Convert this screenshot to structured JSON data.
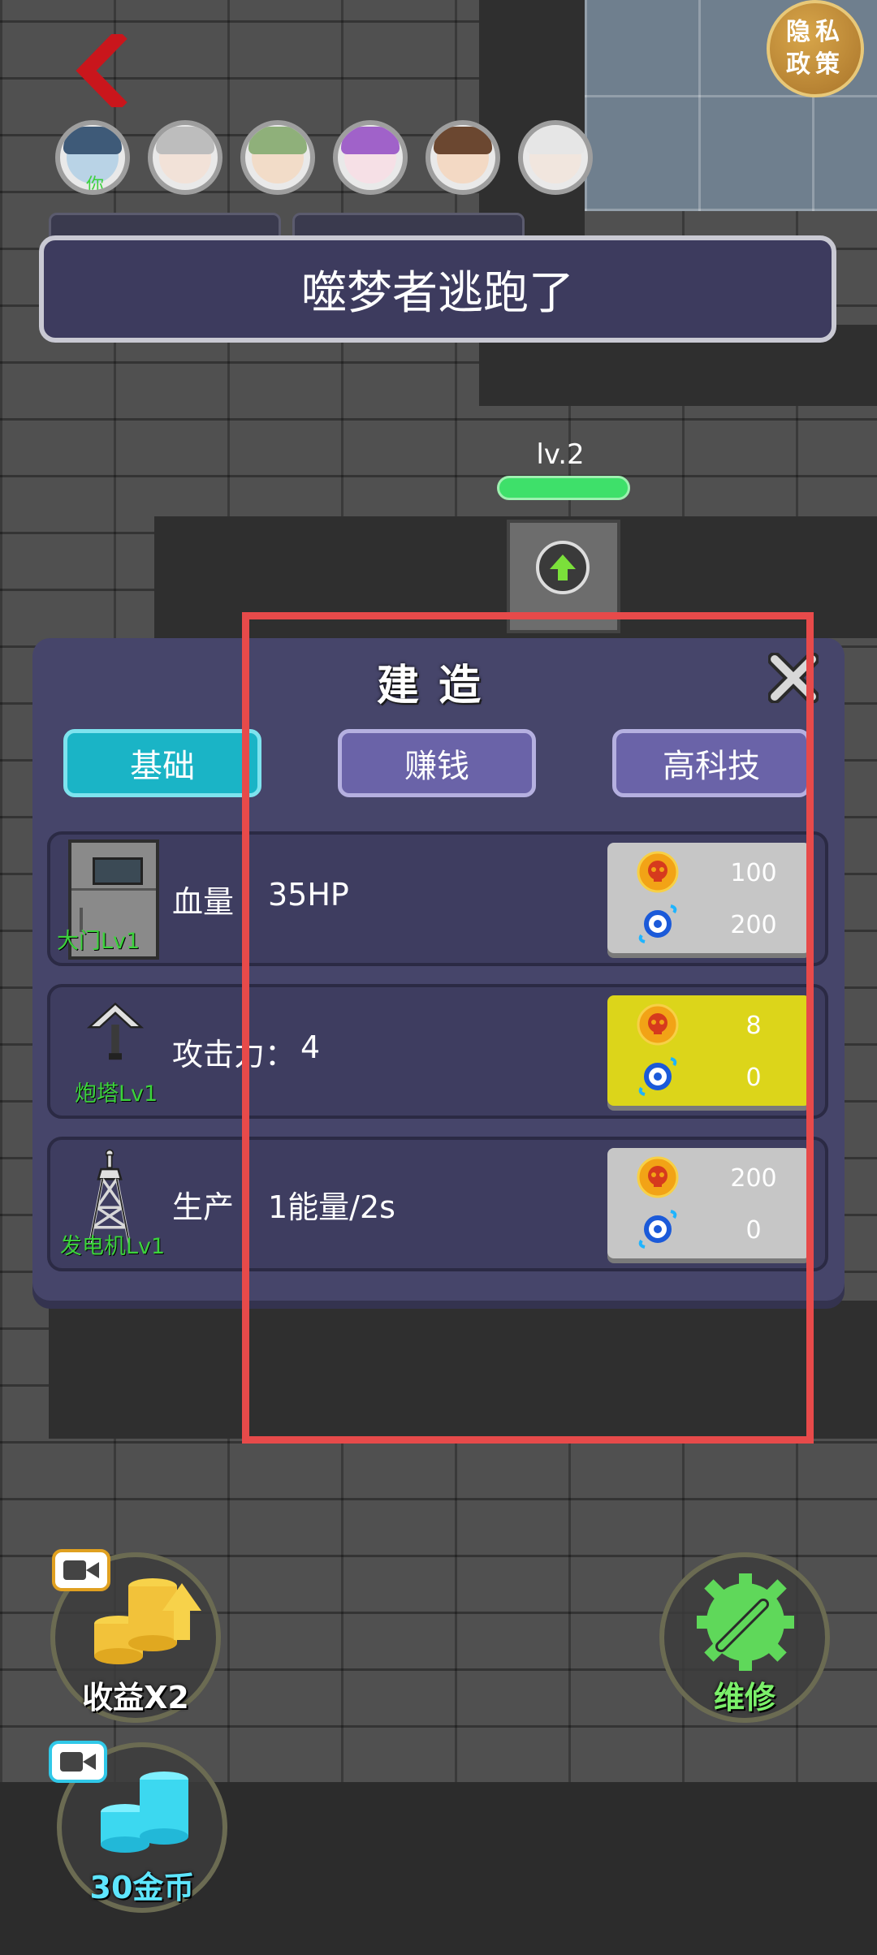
{
  "header": {
    "privacy_label": "隐私\n政策",
    "players": [
      {
        "name": "player-you",
        "tag": "你"
      },
      {
        "name": "player-2"
      },
      {
        "name": "player-3"
      },
      {
        "name": "player-4"
      },
      {
        "name": "player-5"
      },
      {
        "name": "player-6"
      }
    ]
  },
  "banner": {
    "text": "噬梦者逃跑了"
  },
  "building": {
    "level": "lv.2"
  },
  "panel": {
    "title": "建造",
    "tabs": [
      "基础",
      "赚钱",
      "高科技"
    ],
    "items": [
      {
        "name": "大门Lv1",
        "label": "血量",
        "value": "35HP",
        "cost_skull": "100",
        "cost_energy": "200",
        "affordable": false
      },
      {
        "name": "炮塔Lv1",
        "label": "攻击力：",
        "value": "4",
        "cost_skull": "8",
        "cost_energy": "0",
        "affordable": true
      },
      {
        "name": "发电机Lv1",
        "label": "生产",
        "value": "1能量/2s",
        "cost_skull": "200",
        "cost_energy": "0",
        "affordable": false
      }
    ]
  },
  "buttons": {
    "income": "收益X2",
    "repair": "维修",
    "coins": "30金币"
  },
  "colors": {
    "panel": "#46456a",
    "tab_active": "#1ab4c6",
    "tab_idle": "#6a63a8",
    "affordable": "#dcd51a",
    "unaffordable": "#c6c6c6",
    "highlight": "#e74a4a"
  }
}
